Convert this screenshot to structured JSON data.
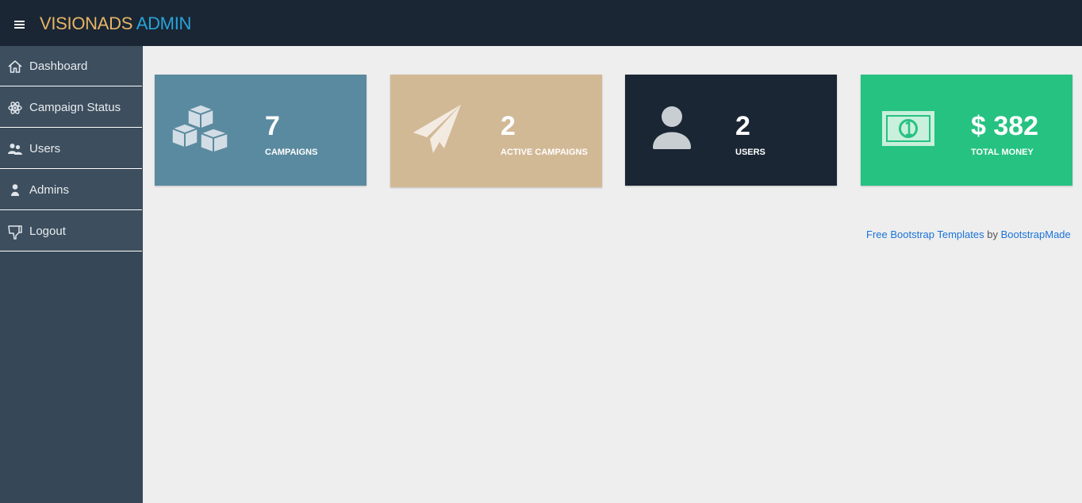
{
  "header": {
    "brand_part1": "VISIONADS",
    "brand_part2": "ADMIN",
    "menu_icon": "hamburger-icon"
  },
  "sidebar": {
    "items": [
      {
        "label": "Dashboard",
        "icon": "home-icon"
      },
      {
        "label": "Campaign Status",
        "icon": "atom-icon"
      },
      {
        "label": "Users",
        "icon": "users-icon"
      },
      {
        "label": "Admins",
        "icon": "user-icon"
      },
      {
        "label": "Logout",
        "icon": "thumbs-down-icon"
      }
    ]
  },
  "cards": [
    {
      "value": "7",
      "caption": "CAMPAIGNS",
      "icon": "cubes-icon",
      "color": "#5a8a9f"
    },
    {
      "value": "2",
      "caption": "ACTIVE CAMPAIGNS",
      "icon": "paper-plane-icon",
      "color": "#d2b996"
    },
    {
      "value": "2",
      "caption": "USERS",
      "icon": "user-icon",
      "color": "#1b2634"
    },
    {
      "value": "$ 382",
      "caption": "TOTAL MONEY",
      "icon": "money-bill-icon",
      "color": "#26c281"
    }
  ],
  "footer": {
    "link1": "Free Bootstrap Templates",
    "by": "by",
    "link2": "BootstrapMade"
  },
  "colors": {
    "topbar": "#1a2634",
    "sidebar": "#364757",
    "brand_orange": "#e6b566",
    "brand_blue": "#29a3d9",
    "background": "#eeeeee"
  }
}
